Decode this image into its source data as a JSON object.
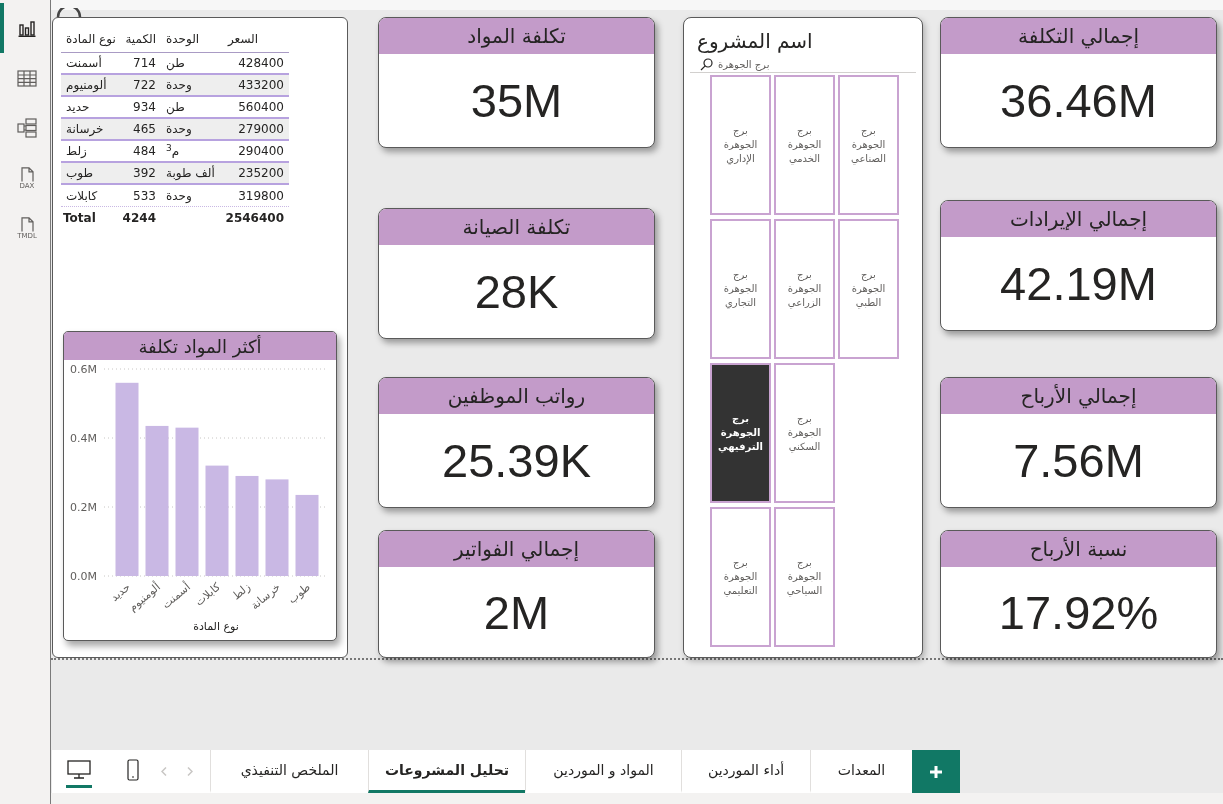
{
  "sidebar": {
    "items": [
      {
        "kind": "report",
        "selected": true
      },
      {
        "kind": "table",
        "selected": false
      },
      {
        "kind": "model",
        "selected": false
      },
      {
        "kind": "dax",
        "label": "DAX",
        "selected": false
      },
      {
        "kind": "tmdl",
        "label": "TMDL",
        "selected": false
      }
    ]
  },
  "materials_table": {
    "columns": [
      "السعر",
      "الوحدة",
      "الكمية",
      "نوع المادة"
    ],
    "rows": [
      [
        "428400",
        "طن",
        "714",
        "أسمنت"
      ],
      [
        "433200",
        "وحدة",
        "722",
        "ألومنيوم"
      ],
      [
        "560400",
        "طن",
        "934",
        "حديد"
      ],
      [
        "279000",
        "وحدة",
        "465",
        "خرسانة"
      ],
      [
        "290400",
        "م$^{3}$",
        "484",
        "زلط"
      ],
      [
        "235200",
        "ألف طوبة",
        "392",
        "طوب"
      ],
      [
        "319800",
        "وحدة",
        "533",
        "كابلات"
      ]
    ],
    "total": {
      "price": "2546400",
      "quantity": "4244",
      "label": "Total"
    }
  },
  "top_materials_chart": {
    "chart_data": [
      {
        "type": "bar",
        "title": "أكثر المواد تكلفة",
        "xlabel": "نوع المادة",
        "categories": [
          "حديد",
          "ألومنيوم",
          "أسمنت",
          "كابلات",
          "زلط",
          "خرسانة",
          "طوب"
        ],
        "values": [
          560000,
          435000,
          430000,
          320000,
          290000,
          280000,
          235000
        ],
        "color": "#c9b8e4",
        "ylim": [
          0,
          600000
        ],
        "yticks": [
          {
            "value": 0,
            "label": "0.0M"
          },
          {
            "value": 200000,
            "label": "0.2M"
          },
          {
            "value": 400000,
            "label": "0.4M"
          },
          {
            "value": 600000,
            "label": "0.6M"
          }
        ],
        "grid": true
      }
    ]
  },
  "cost_cards": [
    {
      "title": "تكلفة المواد",
      "value": "35M"
    },
    {
      "title": "تكلفة الصيانة",
      "value": "28K"
    },
    {
      "title": "رواتب الموظفين",
      "value": "25.39K"
    },
    {
      "title": "إجمالي الفواتير",
      "value": "2M"
    }
  ],
  "project_slicer": {
    "title": "اسم المشروع",
    "search": {
      "value": "برج الجوهرة"
    },
    "items": [
      {
        "label": "برج الجوهرة الصناعي",
        "selected": false
      },
      {
        "label": "برج الجوهرة الخدمي",
        "selected": false
      },
      {
        "label": "برج الجوهرة الإداري",
        "selected": false
      },
      {
        "label": "برج الجوهرة الطبي",
        "selected": false
      },
      {
        "label": "برج الجوهرة الزراعي",
        "selected": false
      },
      {
        "label": "برج الجوهرة التجاري",
        "selected": false
      },
      {
        "label": "برج الجوهرة السكني",
        "selected": false
      },
      {
        "label": "برج الجوهرة الترفيهي",
        "selected": true
      },
      {
        "label": "برج الجوهرة السياحي",
        "selected": false
      },
      {
        "label": "برج الجوهرة التعليمي",
        "selected": false
      }
    ]
  },
  "summary_cards": [
    {
      "title": "إجمالي التكلفة",
      "value": "36.46M"
    },
    {
      "title": "إجمالي الإيرادات",
      "value": "42.19M"
    },
    {
      "title": "إجمالي الأرباح",
      "value": "7.56M"
    },
    {
      "title": "نسبة الأرباح",
      "value": "17.92%"
    }
  ],
  "page_navigation": {
    "view_buttons": [
      {
        "kind": "desktop",
        "selected": true
      },
      {
        "kind": "phone",
        "selected": false
      }
    ],
    "tabs": [
      {
        "label": "المعدات",
        "selected": false
      },
      {
        "label": "أداء الموردين",
        "selected": false
      },
      {
        "label": "المواد و الموردين",
        "selected": false
      },
      {
        "label": "تحليل المشروعات",
        "selected": true
      },
      {
        "label": "الملخص التنفيذي",
        "selected": false
      }
    ]
  }
}
